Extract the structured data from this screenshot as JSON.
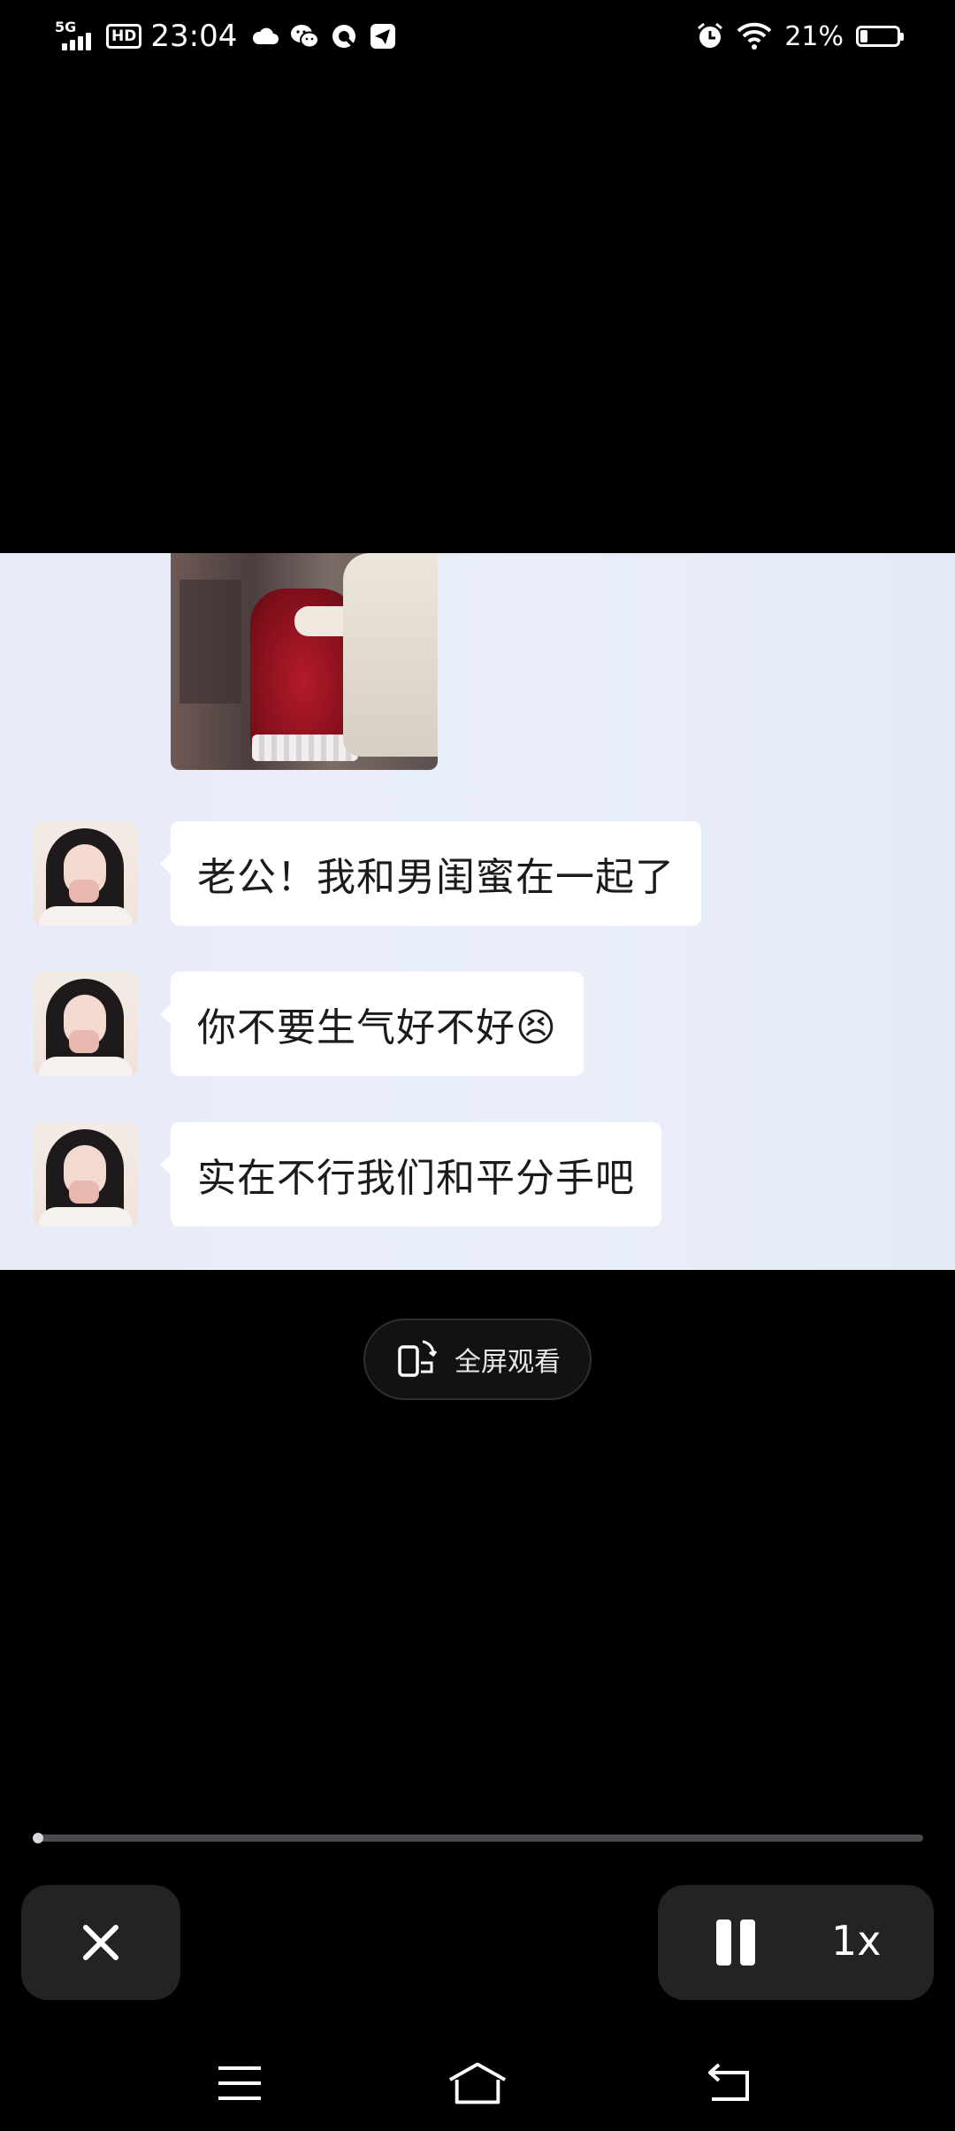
{
  "status_bar": {
    "network": "5G",
    "hd": "HD",
    "time": "23:04",
    "notification_icons": [
      "cloud-icon",
      "wechat-icon",
      "q-icon",
      "telegram-icon"
    ],
    "battery_percent": "21%",
    "battery_level": 0.21
  },
  "video": {
    "messages": [
      {
        "text": "老公！我和男闺蜜在一起了"
      },
      {
        "text": "你不要生气好不好😣"
      },
      {
        "text": "实在不行我们和平分手吧"
      }
    ]
  },
  "fullscreen_button": {
    "label": "全屏观看"
  },
  "player": {
    "progress": 0.005,
    "speed_label": "1x"
  },
  "colors": {
    "background": "#000000",
    "chat_background": "#e7ecf8",
    "bubble": "#ffffff",
    "control_bg": "#232325"
  }
}
